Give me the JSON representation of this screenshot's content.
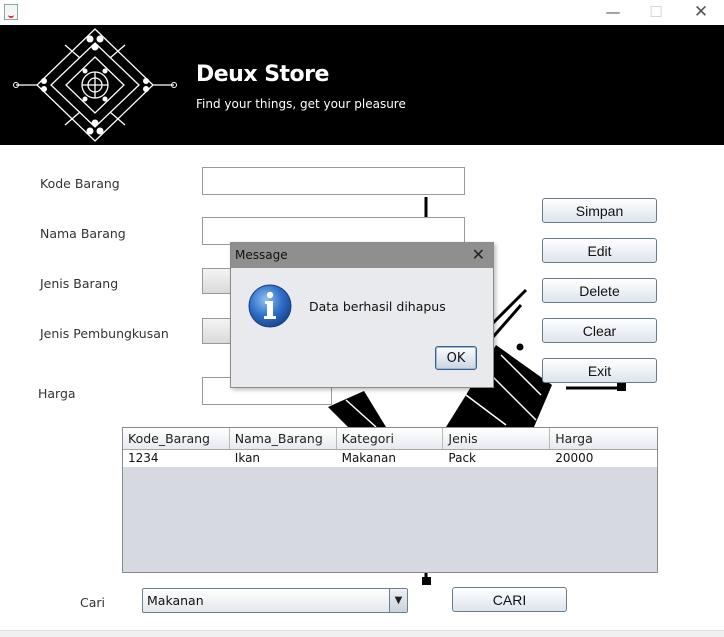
{
  "window": {
    "minimize_glyph": "—",
    "maximize_glyph": "☐",
    "close_glyph": "✕"
  },
  "header": {
    "title": "Deux Store",
    "subtitle": "Find your things, get your pleasure"
  },
  "form": {
    "kode_barang_label": "Kode Barang",
    "nama_barang_label": "Nama Barang",
    "jenis_barang_label": "Jenis Barang",
    "jenis_pembungkusan_label": "Jenis Pembungkusan",
    "harga_label": "Harga",
    "kode_barang_value": "",
    "nama_barang_value": "",
    "harga_value": ""
  },
  "actions": {
    "simpan": "Simpan",
    "edit": "Edit",
    "delete": "Delete",
    "clear": "Clear",
    "exit": "Exit"
  },
  "table": {
    "columns": [
      "Kode_Barang",
      "Nama_Barang",
      "Kategori",
      "Jenis",
      "Harga"
    ],
    "rows": [
      [
        "1234",
        "Ikan",
        "Makanan",
        "Pack",
        "20000"
      ]
    ]
  },
  "search": {
    "label": "Cari",
    "selected": "Makanan",
    "button": "CARI"
  },
  "dialog": {
    "title": "Message",
    "message": "Data berhasil dihapus",
    "ok": "OK",
    "icon": "information-icon"
  },
  "colors": {
    "banner_bg": "#000000",
    "dialog_titlebar": "#8f8f8f",
    "info_icon_blue": "#1f5fb5"
  }
}
